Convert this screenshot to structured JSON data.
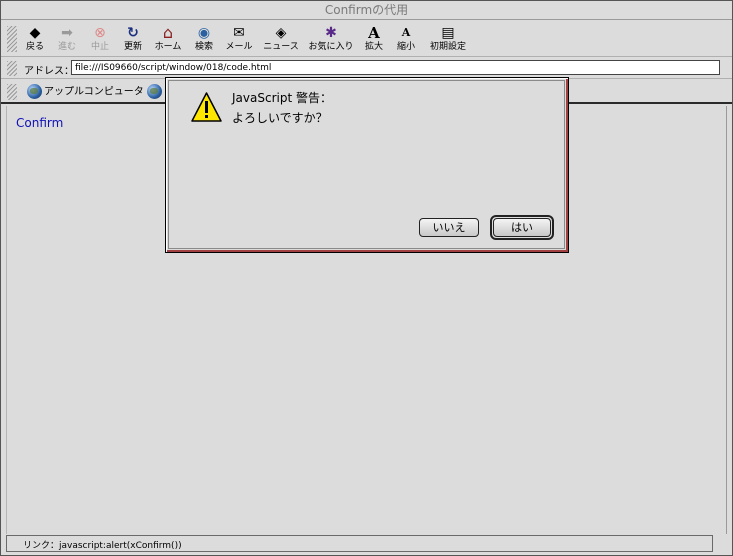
{
  "window": {
    "title": "Confirmの代用"
  },
  "toolbar": {
    "buttons": [
      {
        "label": "戻る",
        "icon": "back-arrow-icon",
        "glyph": "◆"
      },
      {
        "label": "進む",
        "icon": "forward-arrow-icon",
        "glyph": "➡"
      },
      {
        "label": "中止",
        "icon": "stop-icon",
        "glyph": "⊗"
      },
      {
        "label": "更新",
        "icon": "refresh-icon",
        "glyph": "↻"
      },
      {
        "label": "ホーム",
        "icon": "home-icon",
        "glyph": "⌂"
      },
      {
        "label": "検索",
        "icon": "search-globe-icon",
        "glyph": "◉"
      },
      {
        "label": "メール",
        "icon": "mail-icon",
        "glyph": "✉"
      },
      {
        "label": "ニュース",
        "icon": "news-icon",
        "glyph": "◈"
      },
      {
        "label": "お気に入り",
        "icon": "favorites-icon",
        "glyph": "✱"
      },
      {
        "label": "拡大",
        "icon": "text-larger-icon",
        "glyph": "A"
      },
      {
        "label": "縮小",
        "icon": "text-smaller-icon",
        "glyph": "A"
      },
      {
        "label": "初期設定",
        "icon": "preferences-icon",
        "glyph": "▤"
      }
    ]
  },
  "address": {
    "label": "アドレス：",
    "value": "file:///IS09660/script/window/018/code.html"
  },
  "favorites": {
    "items": [
      {
        "label": "アップルコンピュータ"
      }
    ]
  },
  "content": {
    "link_text": "Confirm"
  },
  "dialog": {
    "title": "JavaScript 警告：",
    "message": "よろしいですか？",
    "cancel_label": "いいえ",
    "ok_label": "はい"
  },
  "status": {
    "text": "リンク：javascript:alert(xConfirm())"
  },
  "colors": {
    "link": "#1010b8",
    "window_bg": "#dcdcdc",
    "dialog_accent": "#a04040",
    "warning": "#ffe600"
  }
}
